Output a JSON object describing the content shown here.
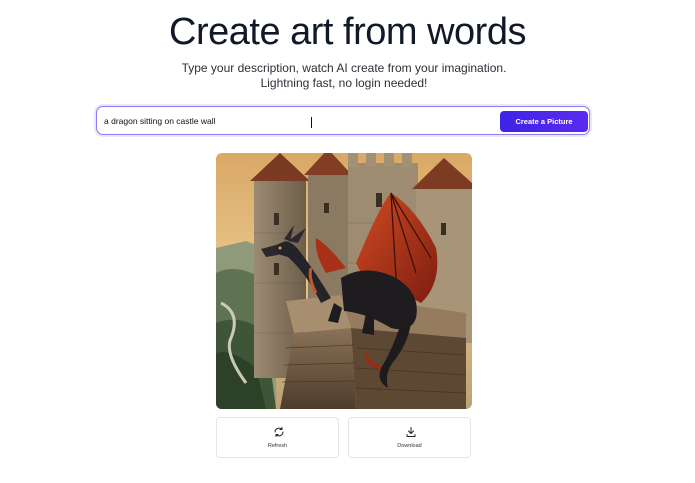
{
  "hero": {
    "title": "Create art from words",
    "subtitle_line1": "Type your description, watch AI create from your imagination.",
    "subtitle_line2": "Lightning fast, no login needed!"
  },
  "prompt": {
    "value": "a dragon sitting on castle wall",
    "button_label": "Create a Picture"
  },
  "image": {
    "subject": "dragon sitting on castle wall painting"
  },
  "actions": {
    "refresh_label": "Refresh",
    "refresh_icon": "refresh-icon",
    "download_label": "Download",
    "download_icon": "download-icon"
  },
  "colors": {
    "accent": "#4a28ec",
    "input_border": "#8b7cf6"
  }
}
